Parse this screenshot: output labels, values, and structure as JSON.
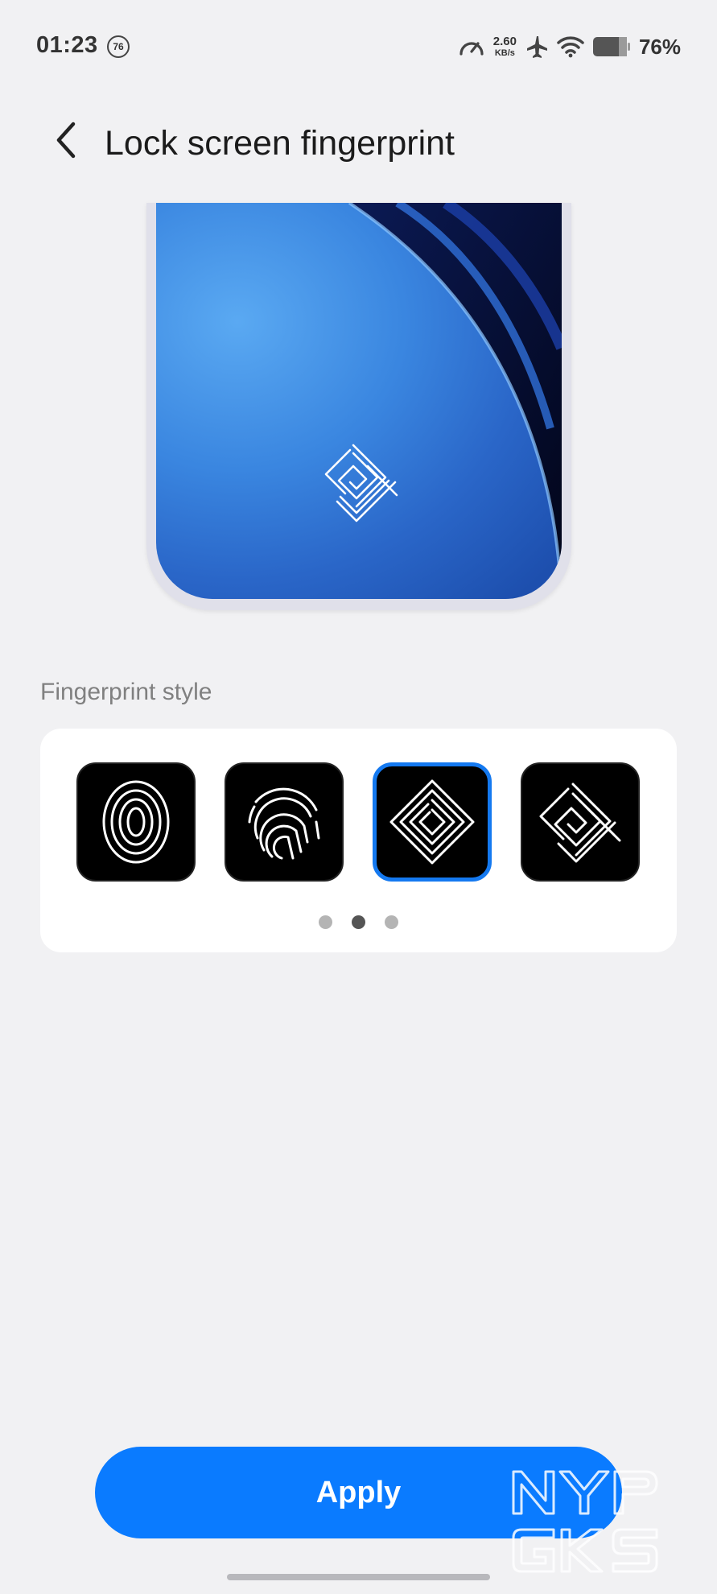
{
  "status_bar": {
    "time": "01:23",
    "notification_badge": "76",
    "net_speed_value": "2.60",
    "net_speed_unit": "KB/s",
    "battery_percent": "76%",
    "icons": [
      "speedometer-icon",
      "airplane-icon",
      "wifi-icon",
      "battery-icon"
    ]
  },
  "header": {
    "title": "Lock screen fingerprint",
    "back_icon": "chevron-left-icon"
  },
  "preview": {
    "selected_style_icon": "diamond-spiral-fingerprint-icon"
  },
  "section": {
    "label": "Fingerprint style"
  },
  "styles": {
    "options": [
      {
        "icon": "oval-fingerprint-icon",
        "selected": false
      },
      {
        "icon": "classic-fingerprint-icon",
        "selected": false
      },
      {
        "icon": "diamond-spiral-fingerprint-icon",
        "selected": true
      },
      {
        "icon": "diamond-lines-fingerprint-icon",
        "selected": false
      }
    ],
    "page_count": 3,
    "active_page": 2
  },
  "actions": {
    "apply_label": "Apply"
  },
  "watermark": {
    "line1": "NYP",
    "line2": "GKS"
  },
  "colors": {
    "accent": "#0a7bff",
    "background": "#f1f1f3",
    "card": "#ffffff",
    "selected_border": "#1479f0"
  }
}
